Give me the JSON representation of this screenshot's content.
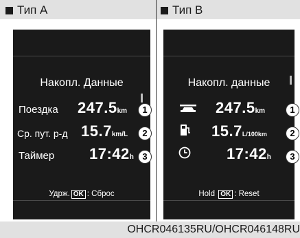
{
  "header": {
    "left": "Тип A",
    "right": "Тип B"
  },
  "panel_a": {
    "title": "Накопл. Данные",
    "rows": [
      {
        "label": "Поездка",
        "value": "247.5",
        "unit": "km",
        "marker": "1"
      },
      {
        "label": "Ср. пут. р-д",
        "value": "15.7",
        "unit": "km/L",
        "marker": "2"
      },
      {
        "label": "Таймер",
        "value": "17:42",
        "unit": "h",
        "marker": "3"
      }
    ],
    "hint": {
      "prefix": "Удрж.",
      "key": "OK",
      "suffix": ": Сброс"
    }
  },
  "panel_b": {
    "title": "Накопл. данные",
    "rows": [
      {
        "icon": "car-icon",
        "value": "247.5",
        "unit": "km",
        "marker": "1"
      },
      {
        "icon": "fuel-pump-icon",
        "value": "15.7",
        "unit": "L/100km",
        "marker": "2"
      },
      {
        "icon": "clock-icon",
        "value": "17:42",
        "unit": "h",
        "marker": "3"
      }
    ],
    "hint": {
      "prefix": "Hold",
      "key": "OK",
      "suffix": ": Reset"
    }
  },
  "footer": {
    "code": "OHCR046135RU/OHCR046148RU"
  }
}
